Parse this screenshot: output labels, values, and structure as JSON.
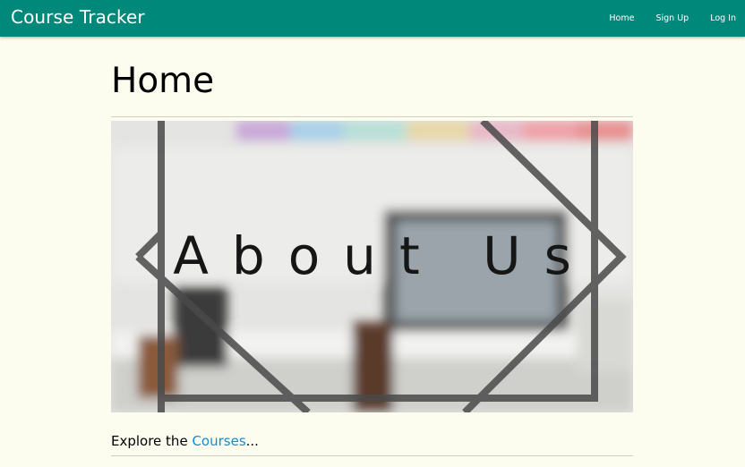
{
  "navbar": {
    "brand": "Course Tracker",
    "links": [
      "Home",
      "Sign Up",
      "Log In"
    ]
  },
  "main": {
    "title": "Home",
    "hero_text": "About Us",
    "explore_prefix": "Explore the ",
    "explore_link": "Courses",
    "explore_suffix": "..."
  },
  "colors": {
    "navbar": "#00897b",
    "background": "#fdfdef",
    "link": "#1a8ad0"
  }
}
